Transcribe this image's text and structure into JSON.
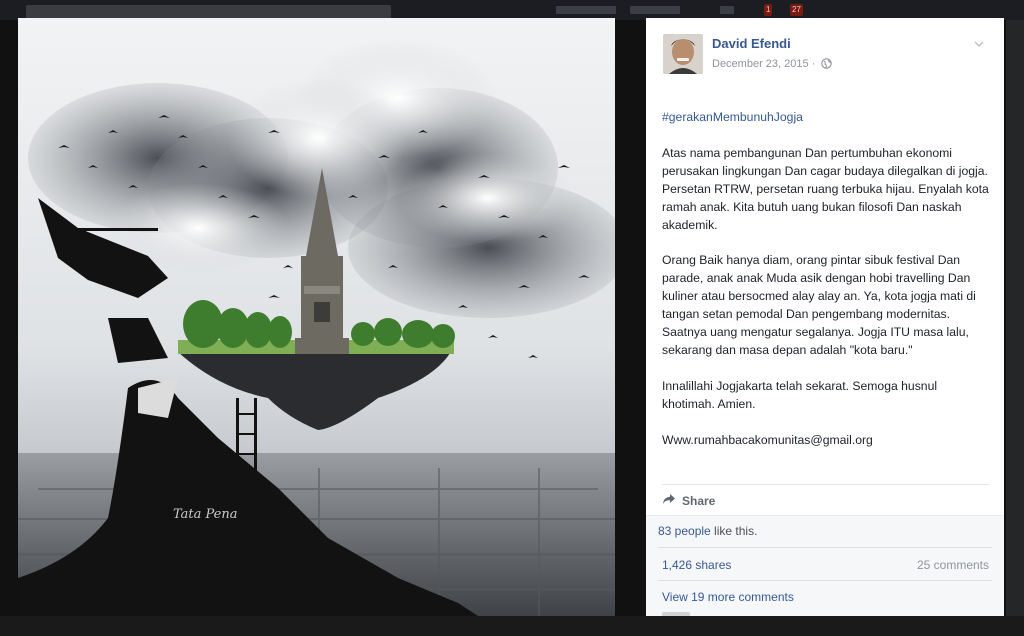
{
  "post": {
    "author_name": "David Efendi",
    "date": "December 23, 2015",
    "date_separator": "·",
    "privacy_icon": "globe-icon",
    "options_icon": "chevron-down-icon",
    "hashtag": "#gerakanMembunuhJogja",
    "paragraphs": [
      "Atas nama pembangunan Dan pertumbuhan ekonomi perusakan lingkungan Dan cagar budaya dilegalkan di jogja. Persetan RTRW, persetan ruang terbuka hijau. Enyalah kota ramah anak. Kita butuh uang bukan filosofi Dan naskah akademik.",
      "Orang Baik hanya diam, orang pintar sibuk festival Dan parade, anak anak Muda asik dengan hobi travelling Dan kuliner atau bersocmed alay alay an. Ya, kota jogja mati di tangan setan pemodal Dan pengembang modernitas. Saatnya uang mengatur segalanya. Jogja ITU masa lalu, sekarang dan masa depan adalah \"kota baru.\"",
      "Innalillahi Jogjakarta telah sekarat. Semoga husnul khotimah. Amien.",
      "Www.rumahbacakomunitas@gmail.org"
    ]
  },
  "actions": {
    "share_label": "Share",
    "share_icon": "share-arrow-icon"
  },
  "feedback": {
    "likes_link": "83 people",
    "likes_suffix": " like this.",
    "shares": "1,426 shares",
    "comments": "25 comments",
    "more_comments": "View 19 more comments"
  },
  "photo": {
    "signature": "Tata Pena",
    "subject": "floating island with Tugu Jogja monument, helicopter, crowd climbing a ladder, birds, clouds over a city"
  },
  "topbar": {
    "badges": [
      "1",
      "27"
    ]
  },
  "colors": {
    "link": "#365899",
    "text": "#1d2129",
    "muted": "#90949c",
    "feedback_bg": "#f6f7f9",
    "lightbox_bg": "#0e0e0e"
  }
}
